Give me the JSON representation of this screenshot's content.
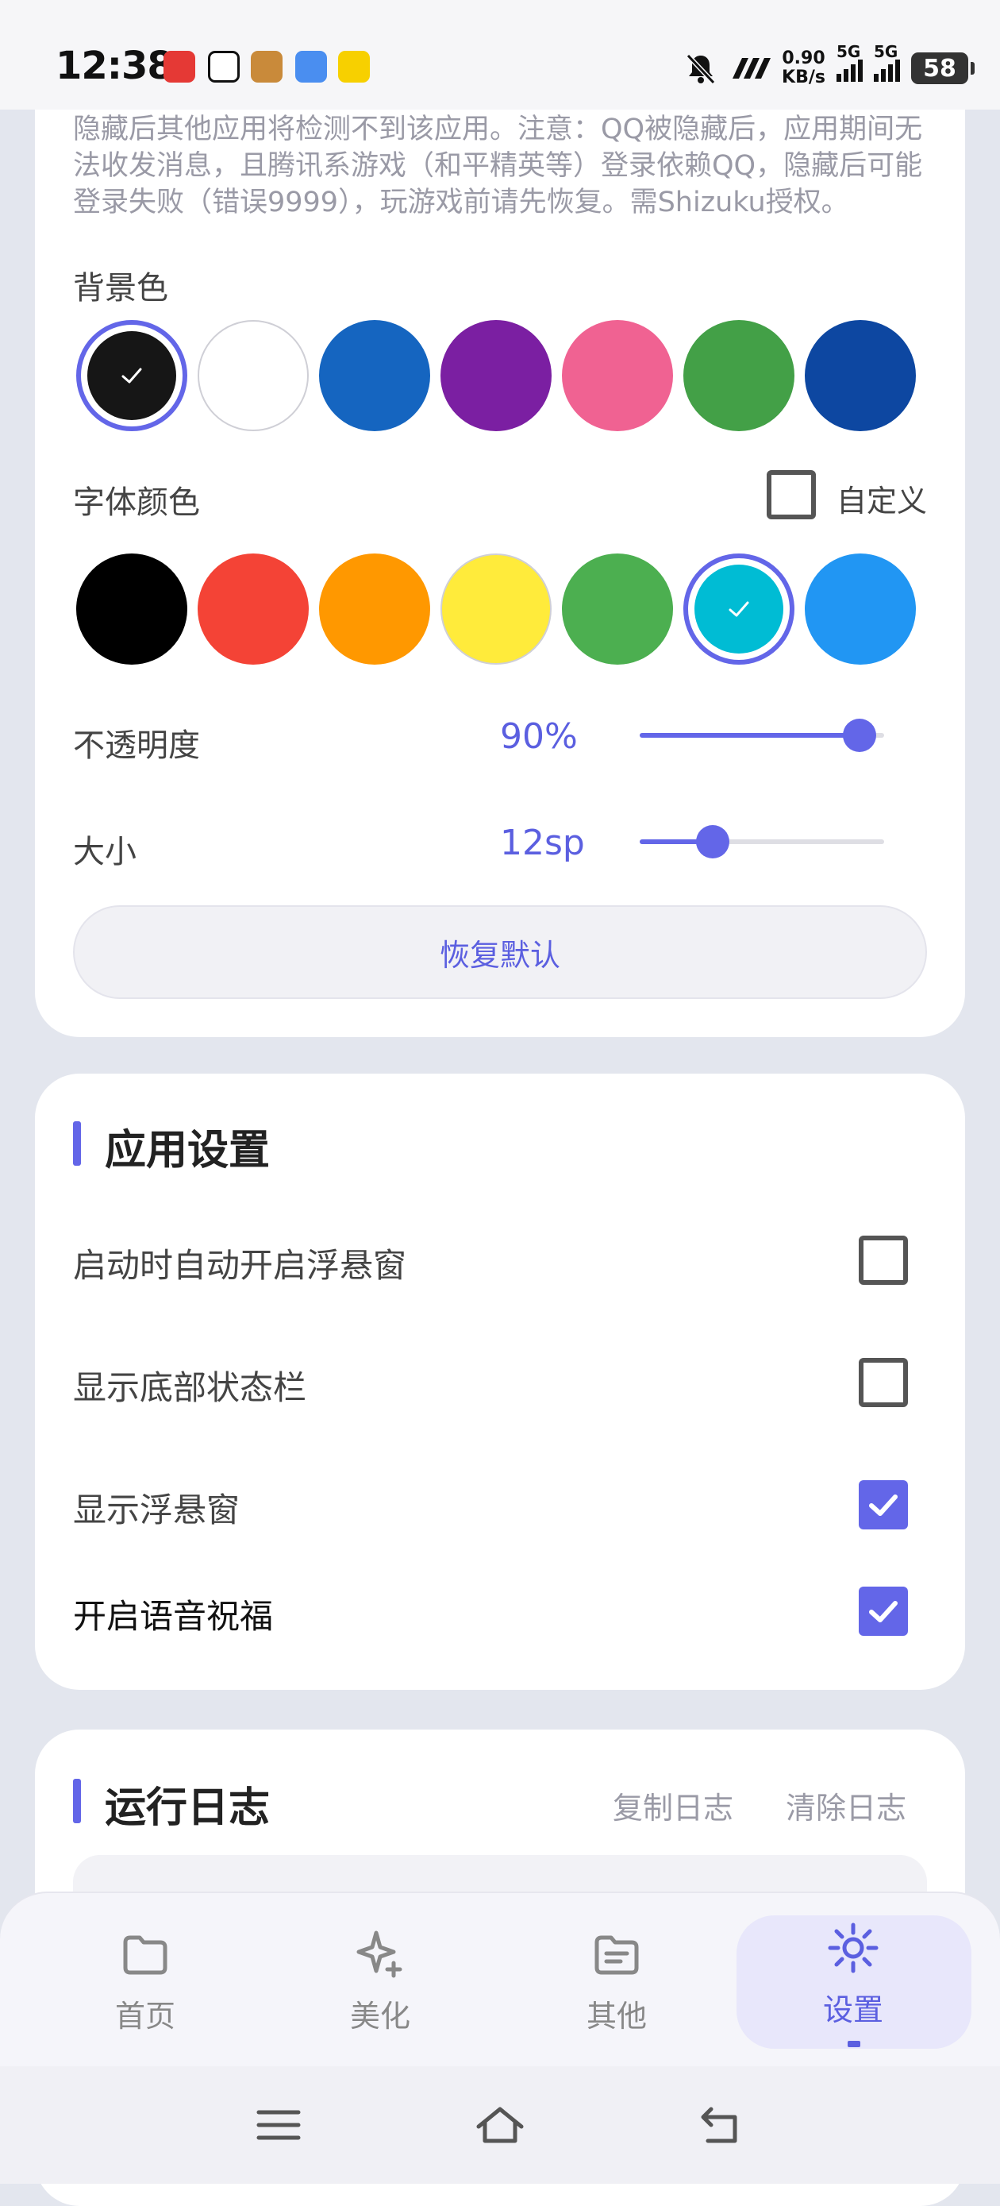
{
  "status_bar": {
    "time": "12:38",
    "net_speed_value": "0.90",
    "net_speed_unit": "KB/s",
    "sim1_tag": "5G",
    "sim2_tag": "5G",
    "battery": "58",
    "icons": [
      "app-notification-icon-red",
      "app-notification-icon-box",
      "game-app-icon",
      "message-app-icon",
      "yellow-app-icon",
      "bell-muted-icon",
      "brand-icon",
      "signal-icon",
      "signal-icon",
      "battery-icon"
    ]
  },
  "appearance": {
    "description": "隐藏后其他应用将检测不到该应用。注意：QQ被隐藏后，应用期间无法收发消息，且腾讯系游戏（和平精英等）登录依赖QQ，隐藏后可能登录失败（错误9999），玩游戏前请先恢复。需Shizuku授权。",
    "background_label": "背景色",
    "background_colors": [
      "#161616",
      "#ffffff",
      "#1565c0",
      "#7b1fa2",
      "#f06292",
      "#43a047",
      "#0d47a1"
    ],
    "background_selected_index": 0,
    "font_color_label": "字体颜色",
    "custom_label": "自定义",
    "custom_checked": false,
    "font_colors": [
      "#000000",
      "#f44336",
      "#ff9800",
      "#ffeb3b",
      "#4caf50",
      "#00bcd4",
      "#2196f3"
    ],
    "font_selected_index": 5,
    "opacity_label": "不透明度",
    "opacity_value": "90%",
    "opacity_fraction": 0.9,
    "size_label": "大小",
    "size_value": "12sp",
    "size_fraction": 0.3,
    "reset_button": "恢复默认"
  },
  "app_settings": {
    "title": "应用设置",
    "items": [
      {
        "label": "启动时自动开启浮悬窗",
        "checked": false
      },
      {
        "label": "显示底部状态栏",
        "checked": false
      },
      {
        "label": "显示浮悬窗",
        "checked": true
      },
      {
        "label": "开启语音祝福",
        "checked": true
      }
    ]
  },
  "log": {
    "title": "运行日志",
    "copy_label": "复制日志",
    "clear_label": "清除日志"
  },
  "bottom_nav": {
    "items": [
      {
        "label": "首页",
        "icon": "folder-icon"
      },
      {
        "label": "美化",
        "icon": "sparkle-icon"
      },
      {
        "label": "其他",
        "icon": "document-folder-icon"
      },
      {
        "label": "设置",
        "icon": "gear-icon"
      }
    ],
    "active_index": 3
  },
  "accent_color": "#6366e8"
}
